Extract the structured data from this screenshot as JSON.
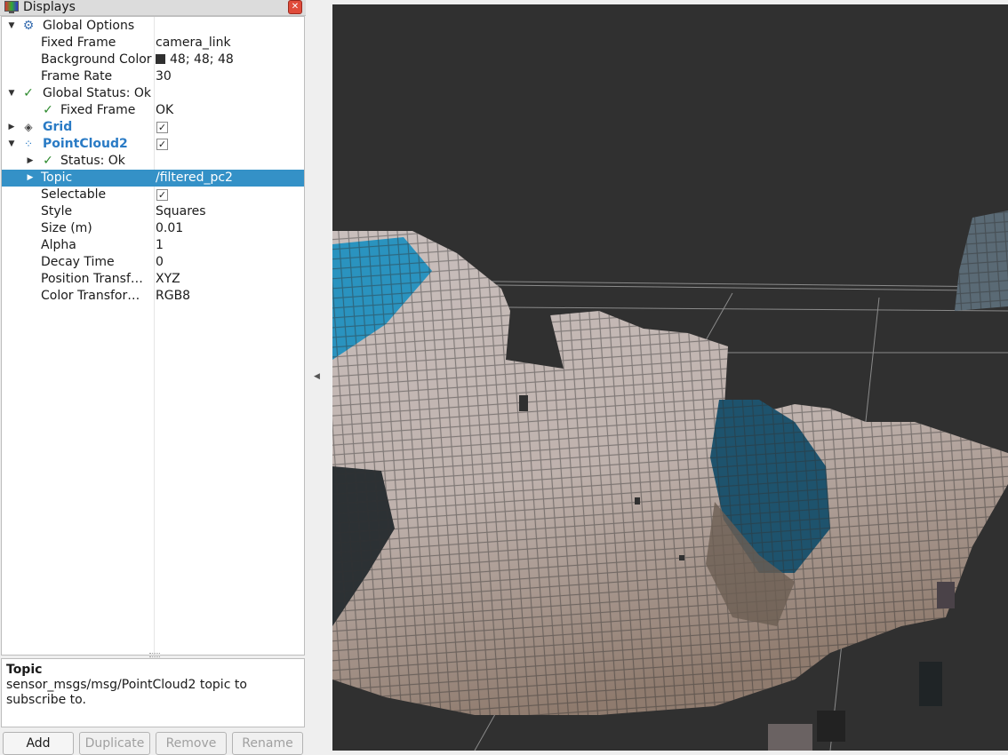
{
  "window": {
    "title": "Displays"
  },
  "tree": {
    "global_options": {
      "label": "Global Options",
      "fixed_frame": {
        "label": "Fixed Frame",
        "value": "camera_link"
      },
      "background_color": {
        "label": "Background Color",
        "value": "48; 48; 48",
        "swatch": "#303030"
      },
      "frame_rate": {
        "label": "Frame Rate",
        "value": "30"
      }
    },
    "global_status": {
      "label": "Global Status: Ok",
      "fixed_frame": {
        "label": "Fixed Frame",
        "value": "OK"
      }
    },
    "grid": {
      "label": "Grid",
      "enabled": true
    },
    "pointcloud2": {
      "label": "PointCloud2",
      "enabled": true,
      "status": {
        "label": "Status: Ok"
      },
      "topic": {
        "label": "Topic",
        "value": "/filtered_pc2"
      },
      "selectable": {
        "label": "Selectable",
        "checked": true
      },
      "style": {
        "label": "Style",
        "value": "Squares"
      },
      "size": {
        "label": "Size (m)",
        "value": "0.01"
      },
      "alpha": {
        "label": "Alpha",
        "value": "1"
      },
      "decay_time": {
        "label": "Decay Time",
        "value": "0"
      },
      "position_transformer": {
        "label": "Position Transf…",
        "value": "XYZ"
      },
      "color_transformer": {
        "label": "Color Transfor…",
        "value": "RGB8"
      }
    }
  },
  "help": {
    "title": "Topic",
    "text": "sensor_msgs/msg/PointCloud2 topic to subscribe to."
  },
  "buttons": {
    "add": "Add",
    "duplicate": "Duplicate",
    "remove": "Remove",
    "rename": "Rename"
  },
  "colors": {
    "selection": "#3491c7",
    "viewport_background": "#303030",
    "status_ok": "#2d8a2d",
    "link_blue": "#2a7bc5"
  }
}
